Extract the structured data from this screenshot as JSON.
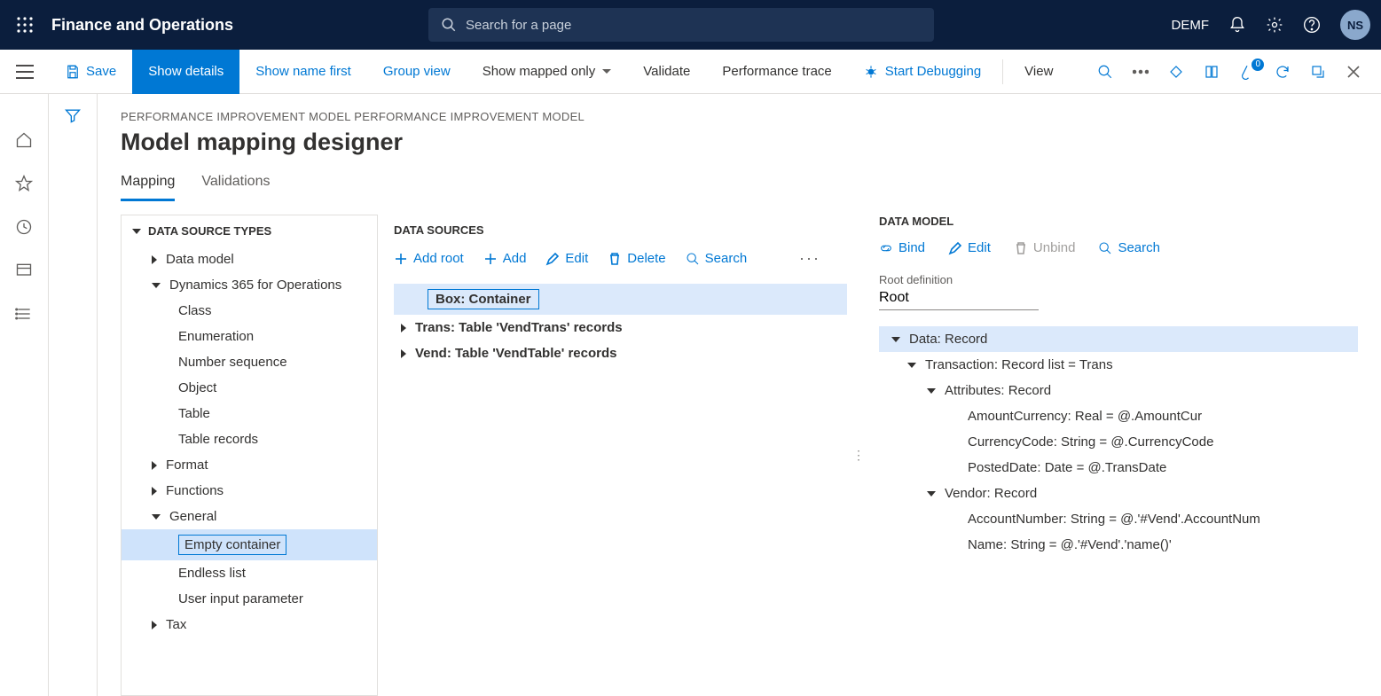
{
  "header": {
    "app_title": "Finance and Operations",
    "search_placeholder": "Search for a page",
    "company": "DEMF",
    "avatar_initials": "NS"
  },
  "toolbar": {
    "save": "Save",
    "show_details": "Show details",
    "show_name_first": "Show name first",
    "group_view": "Group view",
    "show_mapped_only": "Show mapped only",
    "validate": "Validate",
    "performance_trace": "Performance trace",
    "start_debugging": "Start Debugging",
    "view": "View",
    "badge_count": "0"
  },
  "page": {
    "breadcrumb": "PERFORMANCE IMPROVEMENT MODEL PERFORMANCE IMPROVEMENT MODEL",
    "title": "Model mapping designer",
    "tabs": {
      "mapping": "Mapping",
      "validations": "Validations"
    }
  },
  "types_panel": {
    "header": "DATA SOURCE TYPES",
    "data_model": "Data model",
    "d365": "Dynamics 365 for Operations",
    "class": "Class",
    "enum": "Enumeration",
    "numseq": "Number sequence",
    "object": "Object",
    "table": "Table",
    "table_records": "Table records",
    "format": "Format",
    "functions": "Functions",
    "general": "General",
    "empty_container": "Empty container",
    "endless_list": "Endless list",
    "user_input": "User input parameter",
    "tax": "Tax"
  },
  "ds_panel": {
    "header": "DATA SOURCES",
    "add_root": "Add root",
    "add": "Add",
    "edit": "Edit",
    "delete": "Delete",
    "search": "Search",
    "rows": {
      "box": "Box: Container",
      "trans": "Trans: Table 'VendTrans' records",
      "vend": "Vend: Table 'VendTable' records"
    }
  },
  "dm_panel": {
    "header": "DATA MODEL",
    "bind": "Bind",
    "edit": "Edit",
    "unbind": "Unbind",
    "search": "Search",
    "root_label": "Root definition",
    "root_value": "Root",
    "rows": {
      "data": "Data: Record",
      "transaction": "Transaction: Record list = Trans",
      "attributes": "Attributes: Record",
      "amount": "AmountCurrency: Real = @.AmountCur",
      "currency": "CurrencyCode: String = @.CurrencyCode",
      "posted": "PostedDate: Date = @.TransDate",
      "vendor": "Vendor: Record",
      "account": "AccountNumber: String = @.'#Vend'.AccountNum",
      "name": "Name: String = @.'#Vend'.'name()'"
    }
  }
}
